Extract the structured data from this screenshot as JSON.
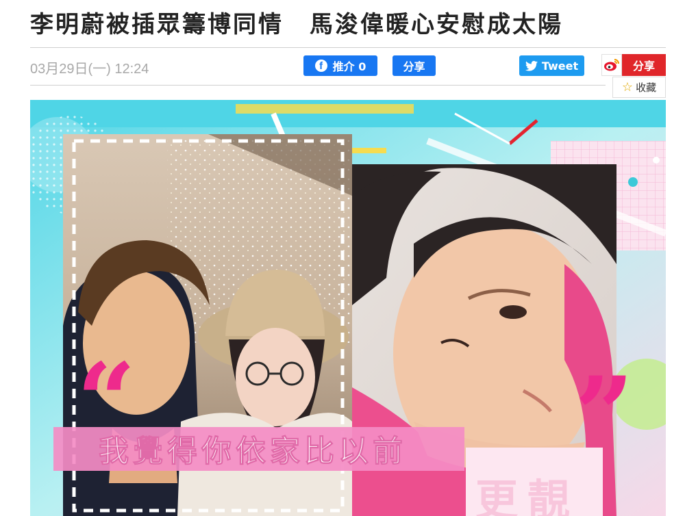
{
  "article": {
    "headline_part1": "李明蔚被插眾籌博同情",
    "headline_part2": "馬浚偉暖心安慰成太陽",
    "date": "03月29日(一) 12:24"
  },
  "share_bar": {
    "fb_like_label": "推介 0",
    "fb_share_label": "分享",
    "tweet_label": "Tweet",
    "weibo_share_label": "分享",
    "favorite_label": "收藏"
  },
  "image": {
    "quote_open": "“",
    "quote_close": "”",
    "caption": "我覺得你依家比以前",
    "caption_emphasis": "更靚"
  },
  "colors": {
    "facebook": "#1877f2",
    "twitter": "#1d9bf0",
    "weibo": "#e0262a",
    "caption_band": "#f48cc4",
    "quote_mark": "#ee2a8c"
  },
  "icons": [
    "facebook-icon",
    "twitter-icon",
    "weibo-icon",
    "star-icon"
  ]
}
